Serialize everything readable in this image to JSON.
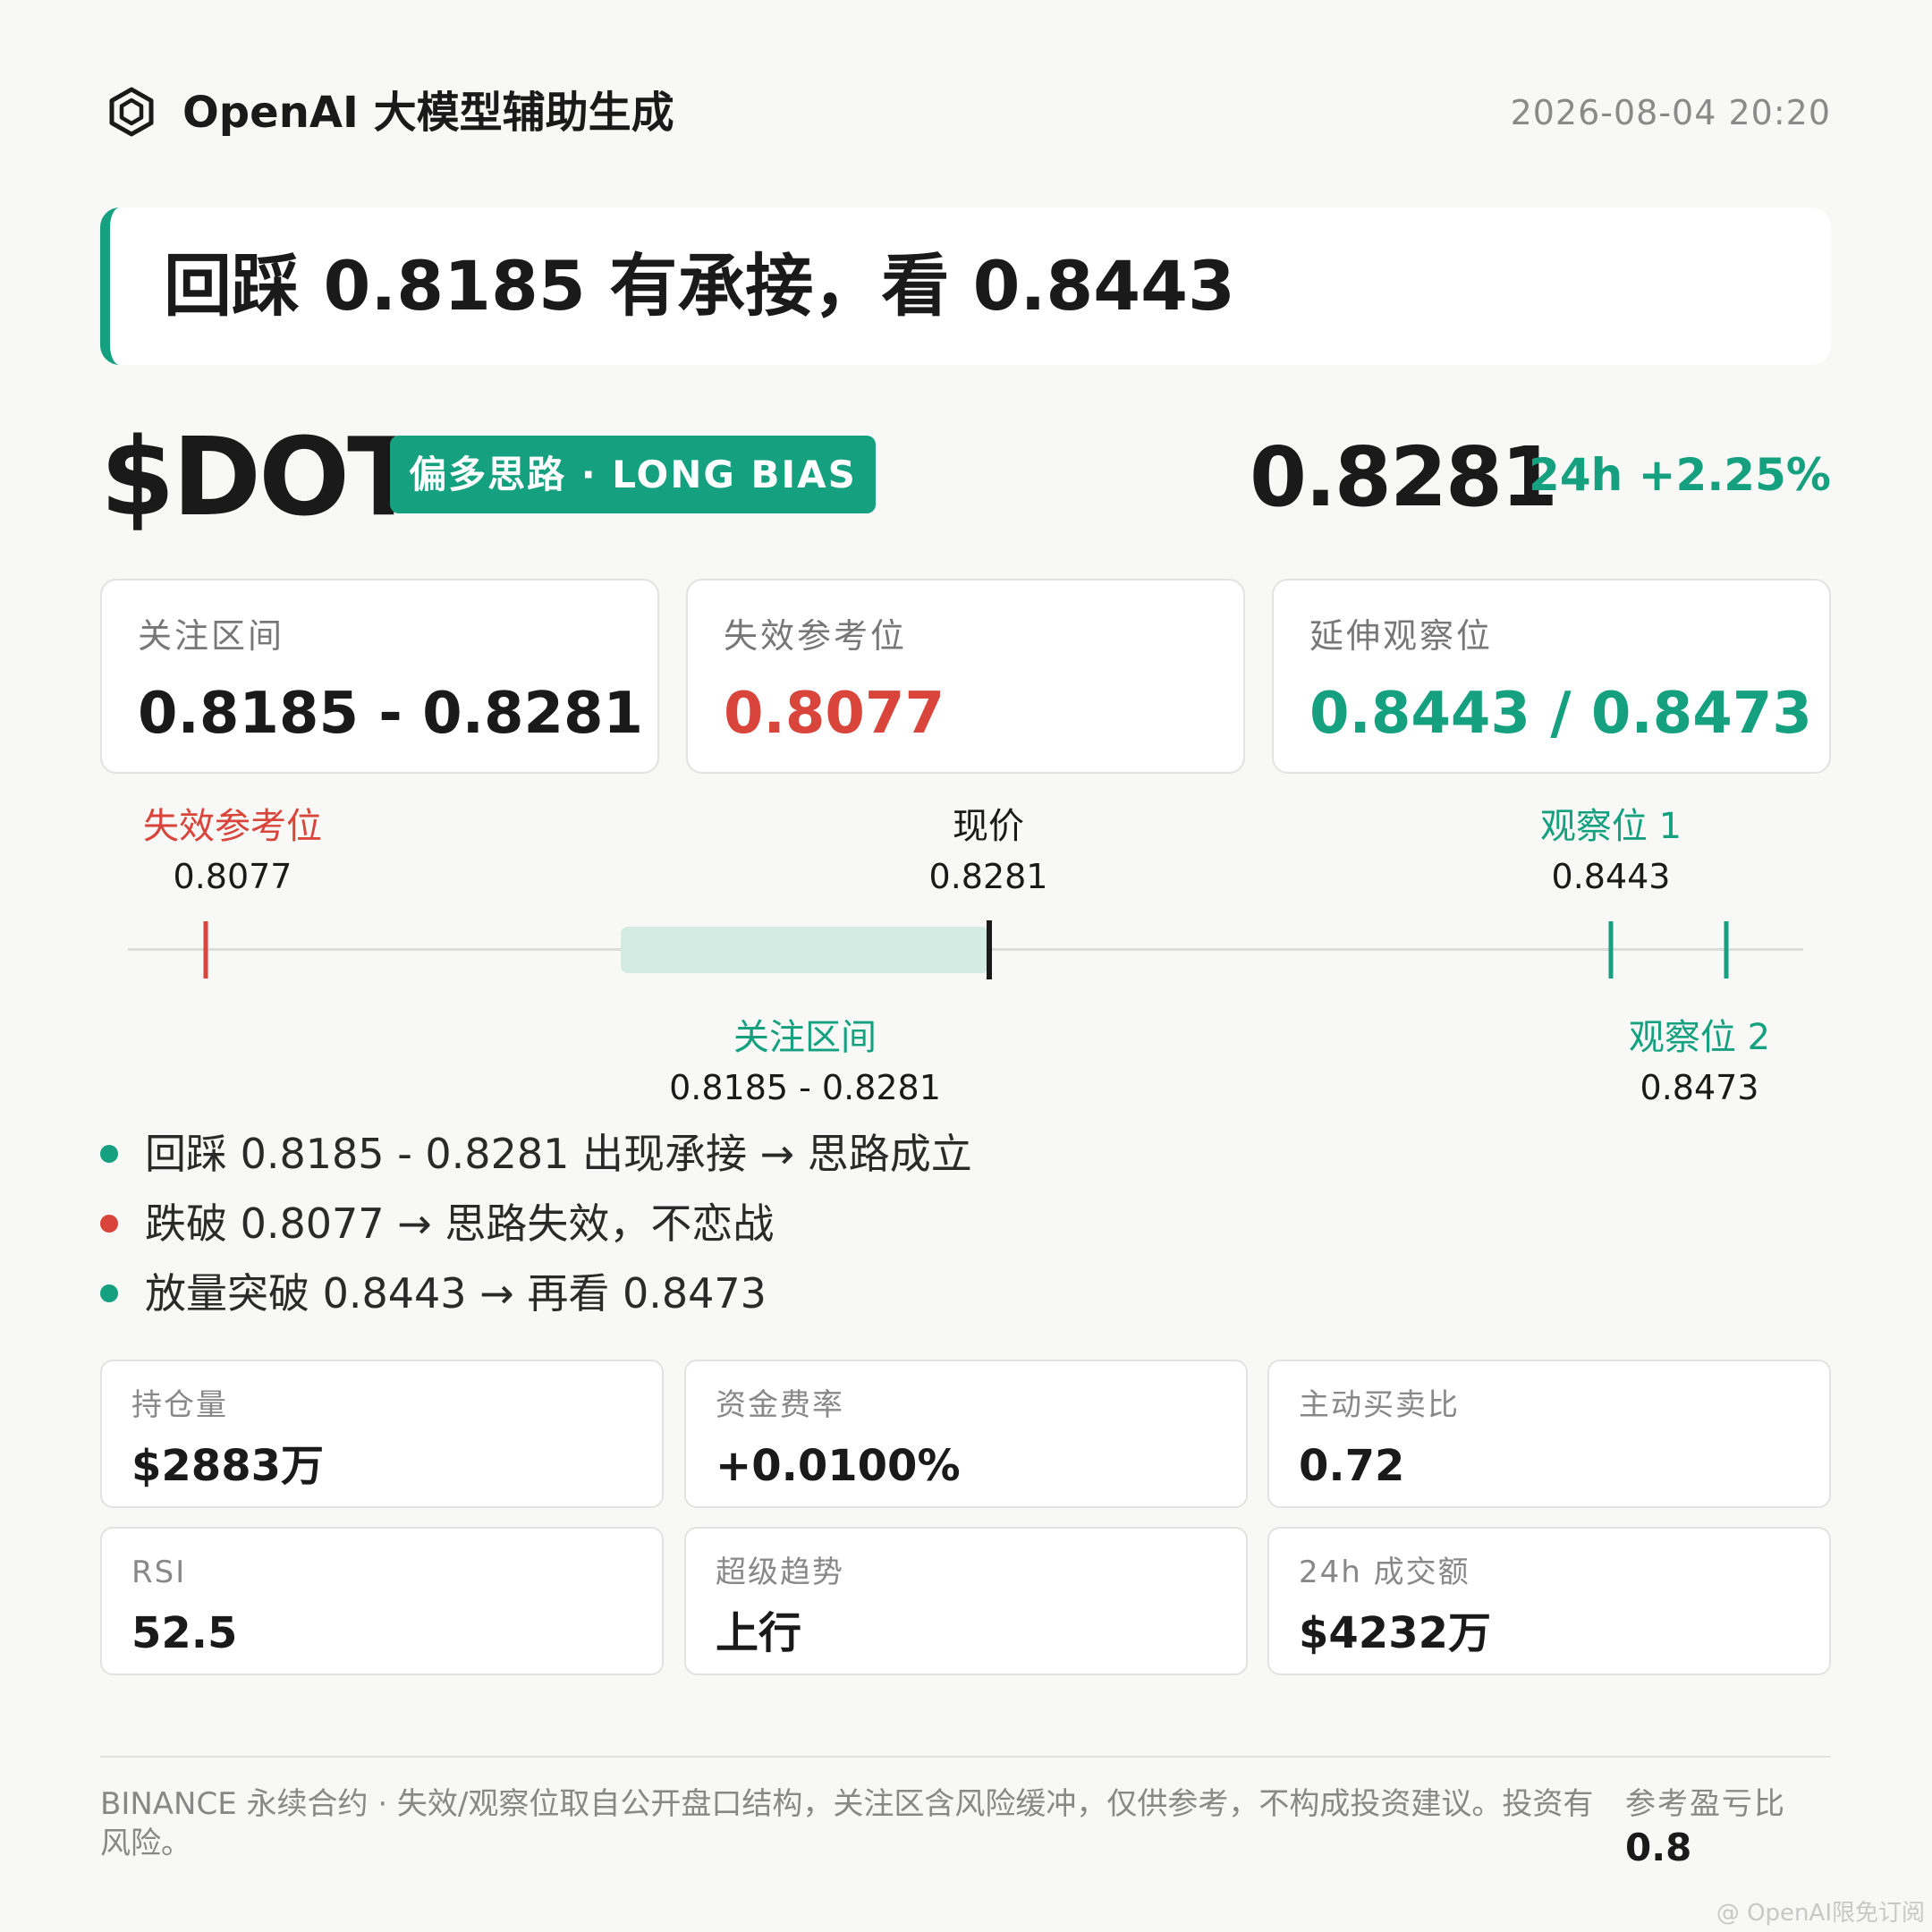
{
  "header": {
    "brand": "OpenAI 大模型辅助生成",
    "icon": "hexagon-logo-icon",
    "timestamp": "2026-08-04 20:20"
  },
  "headline": "回踩 0.8185 有承接，看 0.8443",
  "ticker": {
    "symbol": "$DOT",
    "bias": "偏多思路 · LONG BIAS",
    "price": "0.8281",
    "change": "24h +2.25%"
  },
  "levels": [
    {
      "label": "关注区间",
      "value": "0.8185 - 0.8281",
      "color": "#1a1a1a"
    },
    {
      "label": "失效参考位",
      "value": "0.8077",
      "color": "#d9443b"
    },
    {
      "label": "延伸观察位",
      "value": "0.8443 / 0.8473",
      "color": "#15a17f"
    }
  ],
  "number_line": {
    "invalid": {
      "label": "失效参考位",
      "value": "0.8077"
    },
    "current": {
      "label": "现价",
      "value": "0.8281"
    },
    "target1": {
      "label": "观察位 1",
      "value": "0.8443"
    },
    "zone": {
      "label": "关注区间",
      "value": "0.8185 - 0.8281"
    },
    "target2": {
      "label": "观察位 2",
      "value": "0.8473"
    }
  },
  "bullets": [
    {
      "text": "回踩 0.8185 - 0.8281 出现承接 → 思路成立",
      "color": "#15a17f"
    },
    {
      "text": "跌破 0.8077 → 思路失效，不恋战",
      "color": "#d9443b"
    },
    {
      "text": "放量突破 0.8443 → 再看 0.8473",
      "color": "#15a17f"
    }
  ],
  "metrics": [
    {
      "label": "持仓量",
      "value": "$2883万"
    },
    {
      "label": "资金费率",
      "value": "+0.0100%"
    },
    {
      "label": "主动买卖比",
      "value": "0.72"
    },
    {
      "label": "RSI",
      "value": "52.5"
    },
    {
      "label": "超级趋势",
      "value": "上行"
    },
    {
      "label": "24h 成交额",
      "value": "$4232万"
    }
  ],
  "footer": {
    "disclaimer": "BINANCE 永续合约 · 失效/观察位取自公开盘口结构，关注区含风险缓冲，仅供参考，不构成投资建议。投资有风险。",
    "ratio_label": "参考盈亏比",
    "ratio_value": "0.8"
  },
  "watermark": "@ OpenAI限免订阅",
  "colors": {
    "green": "#15a17f",
    "red": "#d9443b",
    "dark": "#1a1a1a"
  }
}
